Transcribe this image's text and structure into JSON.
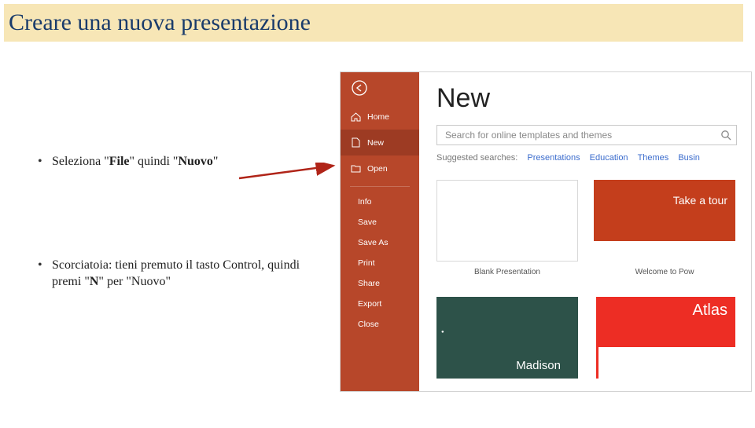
{
  "slide": {
    "title": "Creare una nuova presentazione",
    "bullets": [
      {
        "pre": "Seleziona \"",
        "b1": "File",
        "mid": "\" quindi \"",
        "b2": "Nuovo",
        "post": "\""
      },
      {
        "pre": "Scorciatoia: tieni premuto il tasto Control, quindi premi \"",
        "b1": "N",
        "mid": "\" per \"Nuovo\"",
        "b2": "",
        "post": ""
      }
    ]
  },
  "ppt": {
    "nav": {
      "home": "Home",
      "new": "New",
      "open": "Open",
      "info": "Info",
      "save": "Save",
      "saveas": "Save As",
      "print": "Print",
      "share": "Share",
      "export": "Export",
      "close": "Close"
    },
    "main": {
      "heading": "New",
      "search_placeholder": "Search for online templates and themes",
      "suggest_label": "Suggested searches:",
      "suggest_items": [
        "Presentations",
        "Education",
        "Themes",
        "Busin"
      ],
      "blank_caption": "Blank Presentation",
      "tour_label": "Take a tour",
      "tour_caption": "Welcome to Pow",
      "madison_label": "Madison",
      "atlas_label": "Atlas"
    }
  }
}
